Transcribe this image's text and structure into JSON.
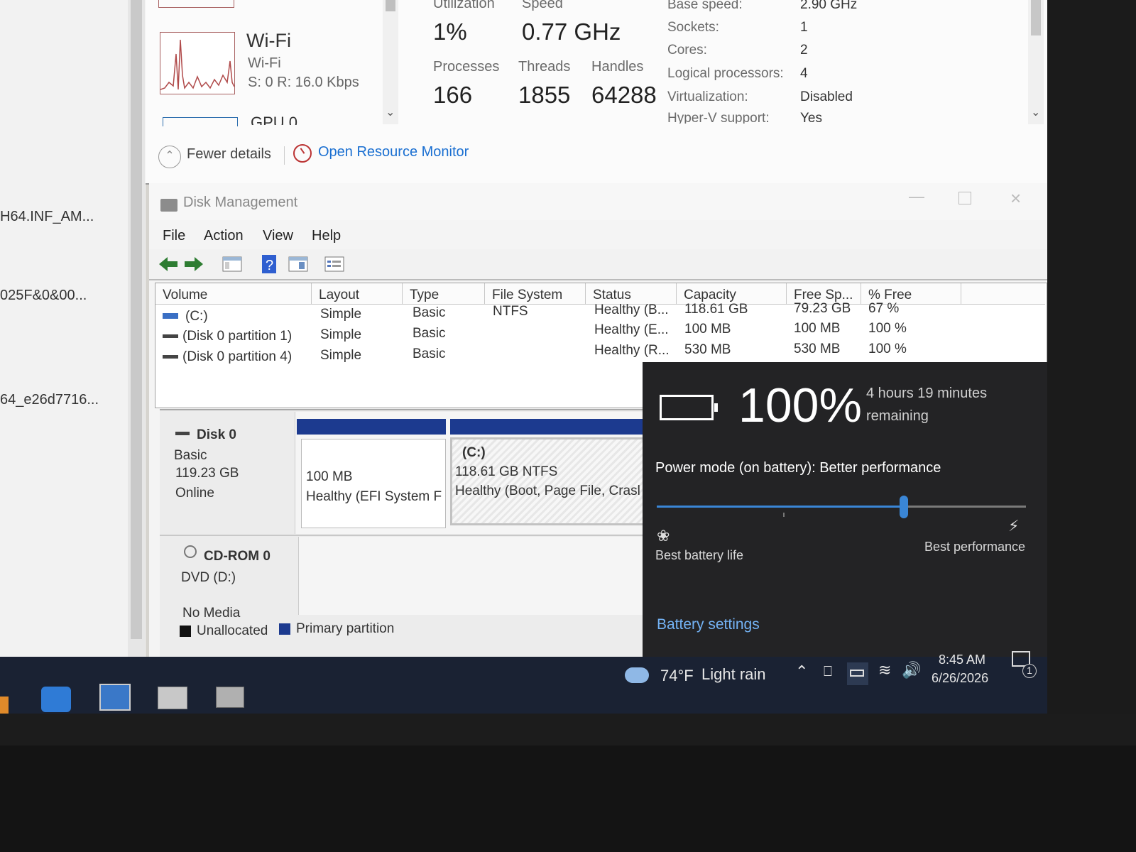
{
  "explorer": {
    "files": [
      "H64.INF_AM...",
      "025F&0&00...",
      "64_e26d7716..."
    ]
  },
  "task_manager": {
    "wifi": {
      "title": "Wi-Fi",
      "subtitle": "Wi-Fi",
      "rate": "S: 0 R: 16.0 Kbps"
    },
    "gpu_partial": "GPU 0",
    "stats": {
      "utilization_label": "Utilization",
      "utilization": "1%",
      "speed_label": "Speed",
      "speed": "0.77 GHz",
      "processes_label": "Processes",
      "processes": "166",
      "threads_label": "Threads",
      "threads": "1855",
      "handles_label": "Handles",
      "handles": "64288"
    },
    "details": [
      {
        "k": "Base speed:",
        "v": "2.90 GHz"
      },
      {
        "k": "Sockets:",
        "v": "1"
      },
      {
        "k": "Cores:",
        "v": "2"
      },
      {
        "k": "Logical processors:",
        "v": "4"
      },
      {
        "k": "Virtualization:",
        "v": "Disabled"
      },
      {
        "k": "Hyper-V support:",
        "v": "Yes"
      }
    ],
    "fewer_details": "Fewer details",
    "open_resource_monitor": "Open Resource Monitor"
  },
  "disk_management": {
    "title": "Disk Management",
    "menu": [
      "File",
      "Action",
      "View",
      "Help"
    ],
    "columns": [
      "Volume",
      "Layout",
      "Type",
      "File System",
      "Status",
      "Capacity",
      "Free Sp...",
      "% Free"
    ],
    "rows": [
      {
        "volume": "(C:)",
        "layout": "Simple",
        "type": "Basic",
        "fs": "NTFS",
        "status": "Healthy (B...",
        "capacity": "118.61 GB",
        "free": "79.23 GB",
        "pct": "67 %"
      },
      {
        "volume": "(Disk 0 partition 1)",
        "layout": "Simple",
        "type": "Basic",
        "fs": "",
        "status": "Healthy (E...",
        "capacity": "100 MB",
        "free": "100 MB",
        "pct": "100 %"
      },
      {
        "volume": "(Disk 0 partition 4)",
        "layout": "Simple",
        "type": "Basic",
        "fs": "",
        "status": "Healthy (R...",
        "capacity": "530 MB",
        "free": "530 MB",
        "pct": "100 %"
      }
    ],
    "disk0": {
      "name": "Disk 0",
      "type": "Basic",
      "size": "119.23 GB",
      "state": "Online",
      "part1": {
        "size": "100 MB",
        "status": "Healthy (EFI System F"
      },
      "part2": {
        "label": "(C:)",
        "size": "118.61 GB NTFS",
        "status": "Healthy (Boot, Page File, Crasl"
      }
    },
    "cdrom": {
      "name": "CD-ROM 0",
      "drive": "DVD (D:)",
      "media": "No Media"
    },
    "legend": {
      "unallocated": "Unallocated",
      "primary": "Primary partition"
    }
  },
  "battery": {
    "percent": "100%",
    "remaining": "4 hours 19 minutes remaining",
    "power_mode": "Power mode (on battery): Better performance",
    "slider_fraction": 0.67,
    "left_label": "Best battery life",
    "right_label": "Best performance",
    "settings": "Battery settings"
  },
  "taskbar": {
    "weather_temp": "74°F",
    "weather_desc": "Light rain",
    "time": "8:45 AM",
    "date": "6/26/2026",
    "notification_count": "1"
  },
  "colors": {
    "accent": "#3a86d6",
    "link": "#1a6fd1",
    "flyout_bg": "#232325",
    "partition_blue": "#1c3a8f"
  }
}
